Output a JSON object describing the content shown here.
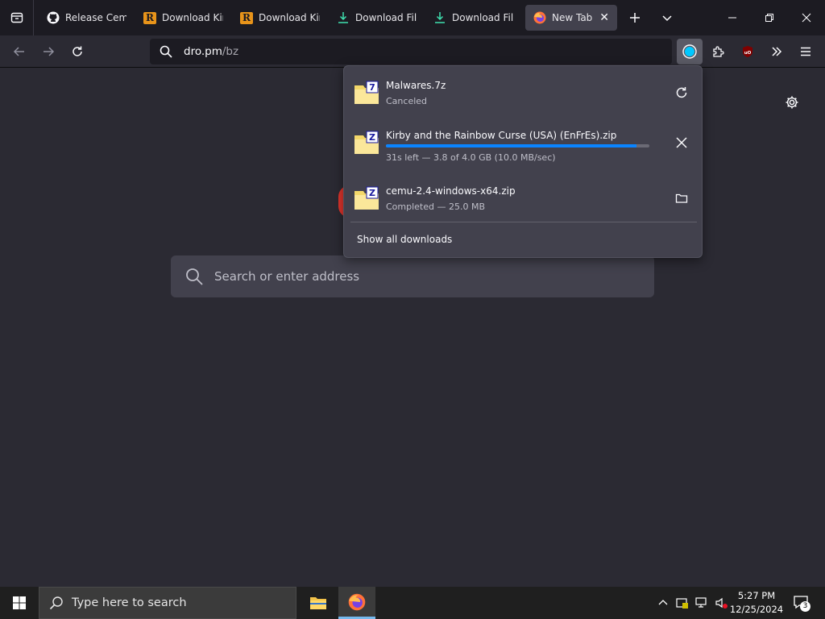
{
  "tabs": [
    {
      "label": "Release Cemu",
      "icon": "github-icon"
    },
    {
      "label": "Download Kirl",
      "icon": "r-logo-icon",
      "badge": "R"
    },
    {
      "label": "Download Kirl",
      "icon": "r-logo-icon",
      "badge": "R"
    },
    {
      "label": "Download File",
      "icon": "download-icon"
    },
    {
      "label": "Download File",
      "icon": "download-icon"
    },
    {
      "label": "New Tab",
      "icon": "firefox-icon",
      "active": true
    }
  ],
  "address": {
    "host": "dro.pm",
    "path": "/bz"
  },
  "downloads": [
    {
      "name": "Malwares.7z",
      "status": "Canceled",
      "badge": "7",
      "action": "retry-icon"
    },
    {
      "name": "Kirby and the Rainbow Curse (USA) (EnFrEs).zip",
      "status": "31s left — 3.8 of 4.0 GB (10.0 MB/sec)",
      "badge": "Z",
      "action": "close-icon",
      "progress": 0.95
    },
    {
      "name": "cemu-2.4-windows-x64.zip",
      "status": "Completed — 25.0 MB",
      "badge": "Z",
      "action": "folder-icon"
    }
  ],
  "show_all": "Show all downloads",
  "newtab": {
    "search_placeholder": "Search or enter address"
  },
  "taskbar": {
    "search_placeholder": "Type here to search",
    "time": "5:27 PM",
    "date": "12/25/2024",
    "notifications": "3"
  },
  "colors": {
    "accent": "#0a84ff",
    "tabbar": "#1c1b22",
    "content": "#2b2a33",
    "popup": "#42414d"
  }
}
